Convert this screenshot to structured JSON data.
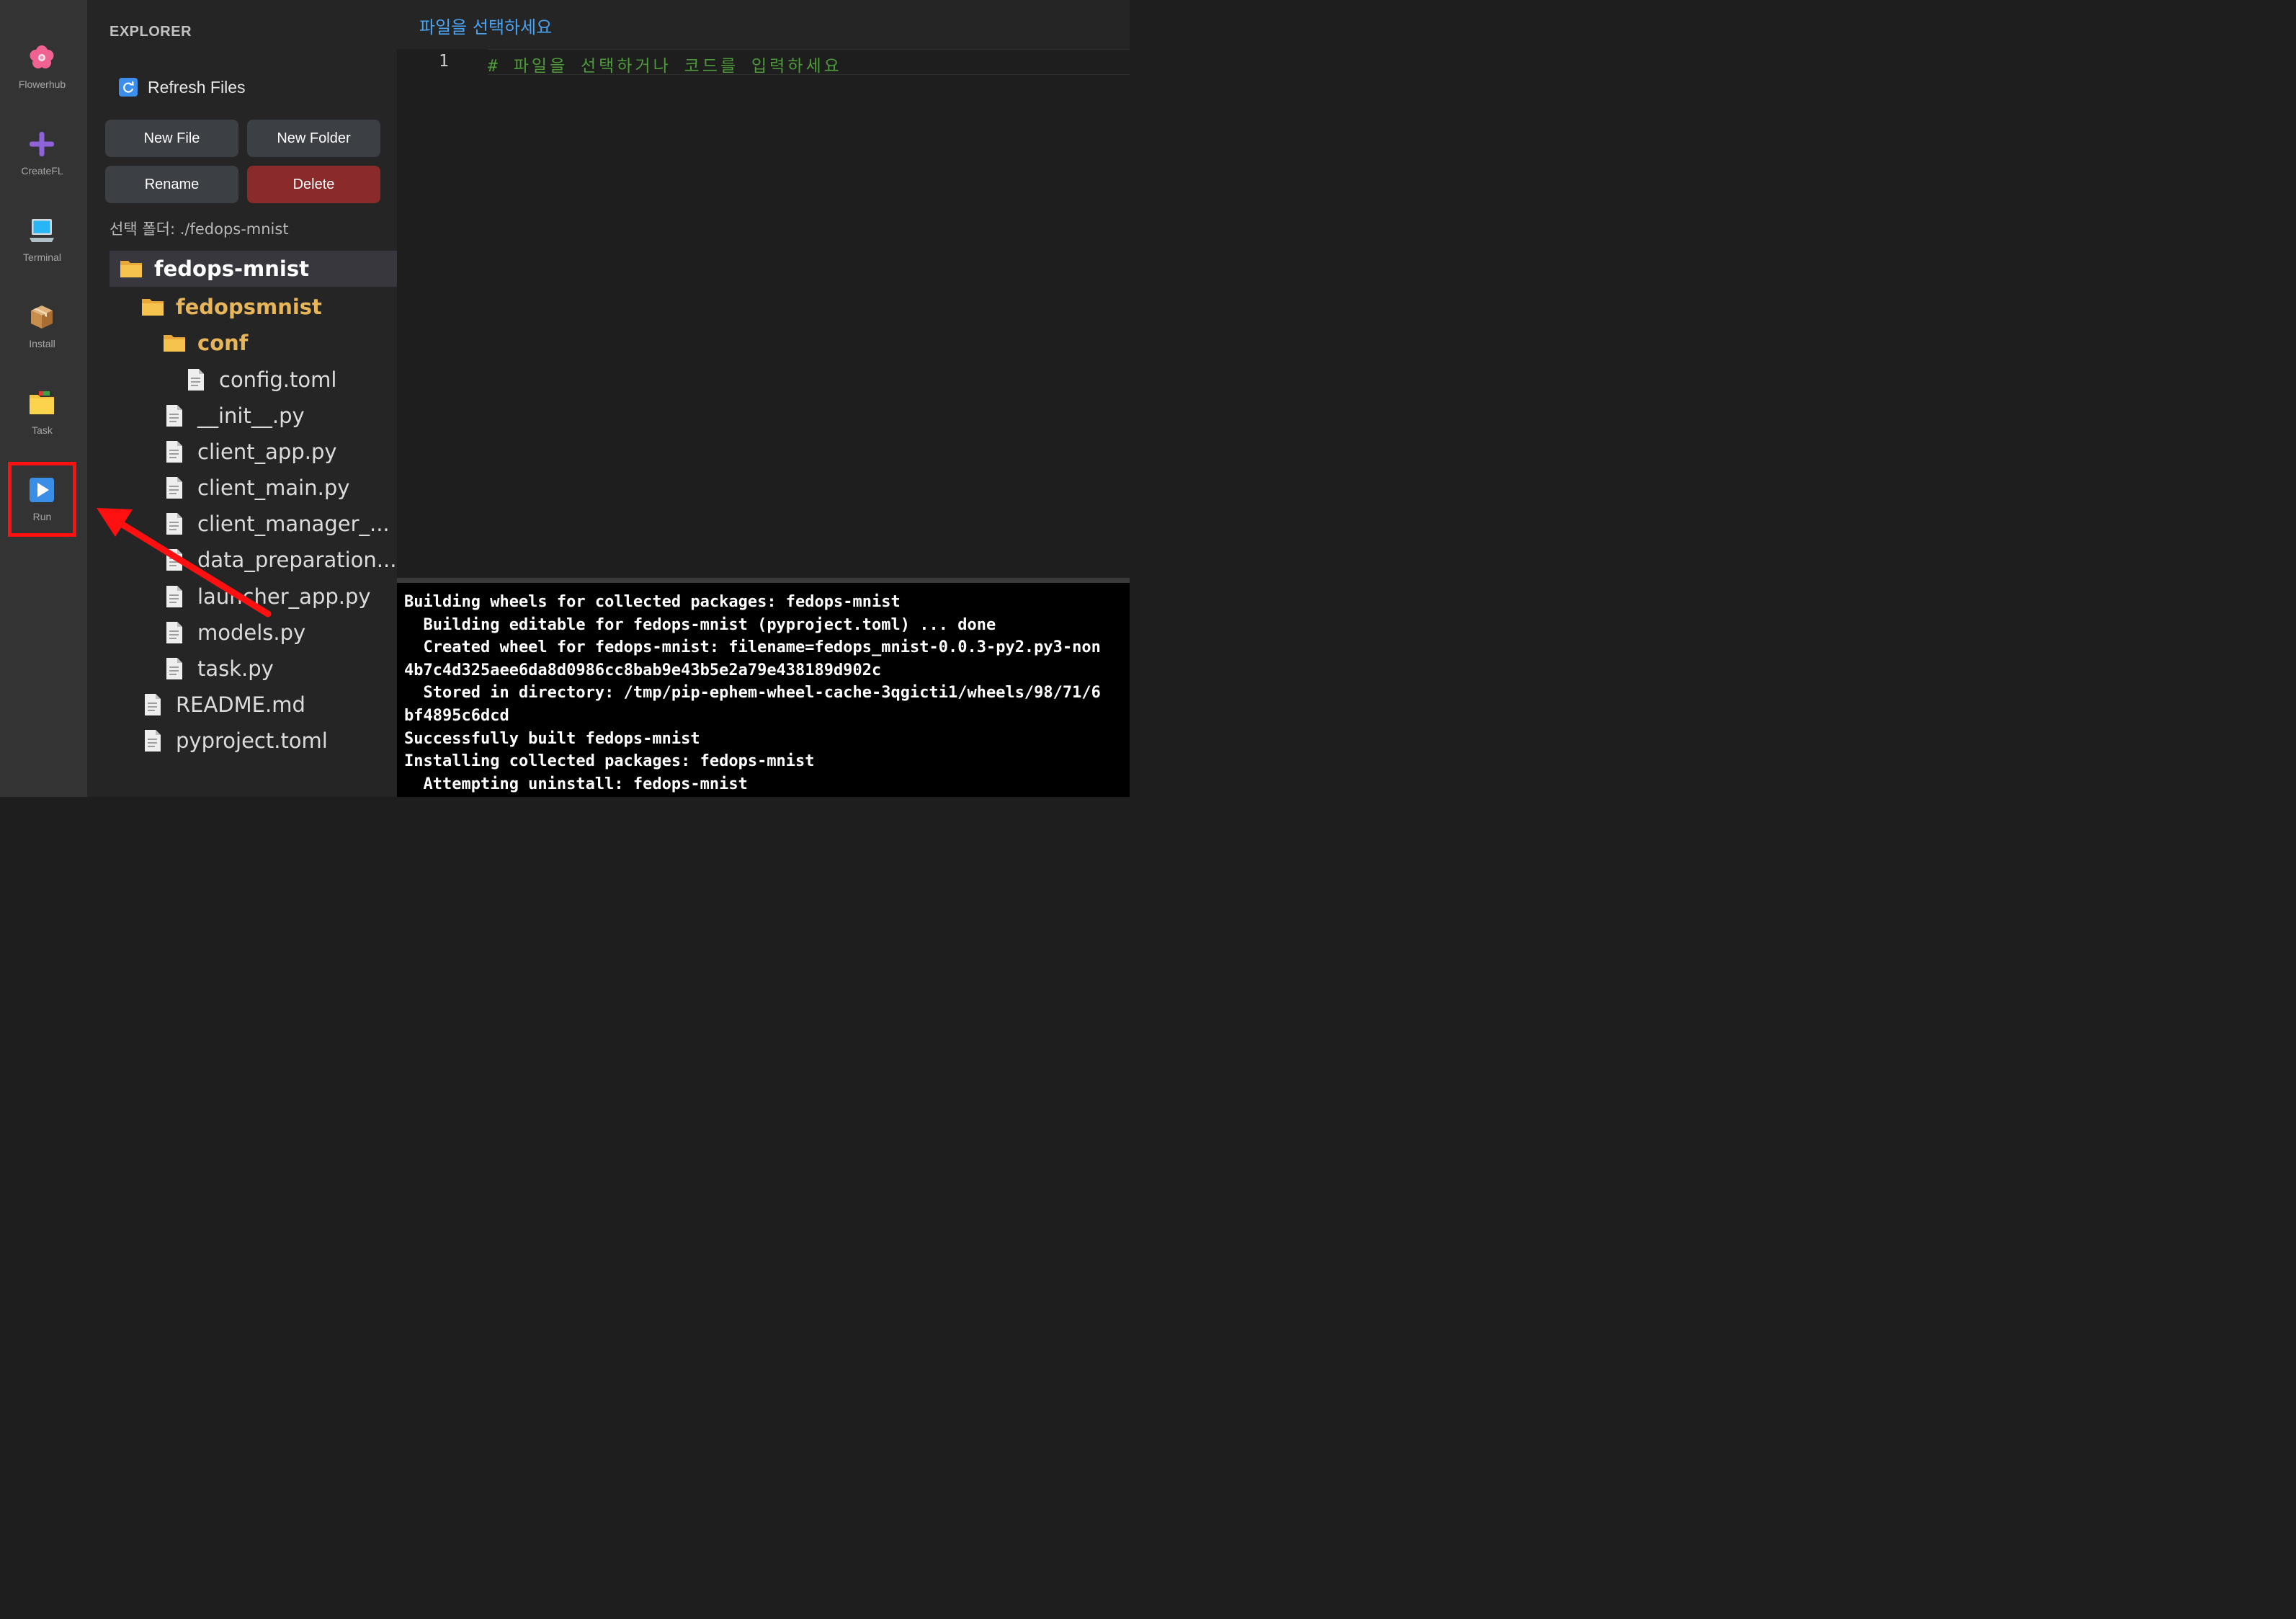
{
  "activity_bar": {
    "items": [
      {
        "label": "Flowerhub",
        "icon": "flower-icon"
      },
      {
        "label": "CreateFL",
        "icon": "plus-icon"
      },
      {
        "label": "Terminal",
        "icon": "laptop-icon"
      },
      {
        "label": "Install",
        "icon": "package-icon"
      },
      {
        "label": "Task",
        "icon": "folder-icon"
      },
      {
        "label": "Run",
        "icon": "play-icon"
      }
    ]
  },
  "explorer": {
    "title": "EXPLORER",
    "refresh_label": "Refresh Files",
    "buttons": {
      "new_file": "New File",
      "new_folder": "New Folder",
      "rename": "Rename",
      "delete": "Delete"
    },
    "selected_folder_label": "선택 폴더: ./fedops-mnist",
    "tree": [
      {
        "name": "fedops-mnist",
        "type": "folder"
      },
      {
        "name": "fedopsmnist",
        "type": "folder"
      },
      {
        "name": "conf",
        "type": "folder"
      },
      {
        "name": "config.toml",
        "type": "file"
      },
      {
        "name": "__init__.py",
        "type": "file"
      },
      {
        "name": "client_app.py",
        "type": "file"
      },
      {
        "name": "client_main.py",
        "type": "file"
      },
      {
        "name": "client_manager_...",
        "type": "file"
      },
      {
        "name": "data_preparation...",
        "type": "file"
      },
      {
        "name": "launcher_app.py",
        "type": "file"
      },
      {
        "name": "models.py",
        "type": "file"
      },
      {
        "name": "task.py",
        "type": "file"
      },
      {
        "name": "README.md",
        "type": "file"
      },
      {
        "name": "pyproject.toml",
        "type": "file"
      }
    ]
  },
  "editor": {
    "title": "파일을 선택하세요",
    "line_number": "1",
    "code": "# 파일을 선택하거나 코드를 입력하세요"
  },
  "terminal": {
    "lines": [
      "Building wheels for collected packages: fedops-mnist",
      "  Building editable for fedops-mnist (pyproject.toml) ... done",
      "  Created wheel for fedops-mnist: filename=fedops_mnist-0.0.3-py2.py3-non",
      "4b7c4d325aee6da8d0986cc8bab9e43b5e2a79e438189d902c",
      "  Stored in directory: /tmp/pip-ephem-wheel-cache-3qgicti1/wheels/98/71/6",
      "bf4895c6dcd",
      "Successfully built fedops-mnist",
      "Installing collected packages: fedops-mnist",
      "  Attempting uninstall: fedops-mnist"
    ]
  },
  "colors": {
    "annotation": "#ff1010",
    "folder": "#e8b65a",
    "delete_button": "#8a2a2a",
    "editor_title": "#4aa3f0",
    "comment": "#4e9a3a"
  }
}
